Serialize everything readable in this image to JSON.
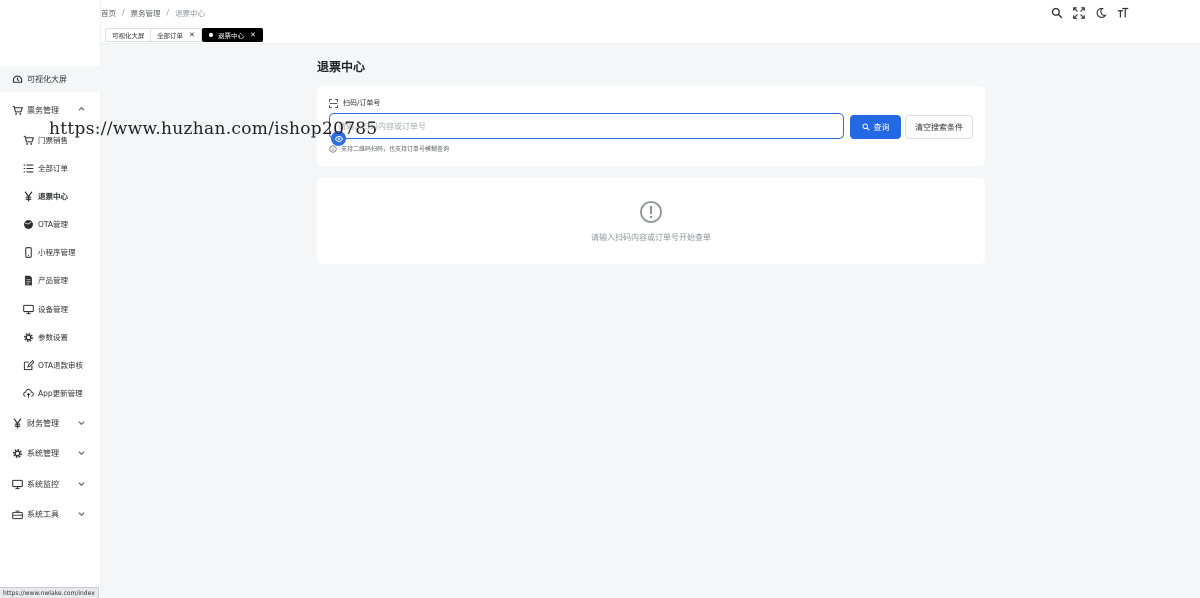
{
  "breadcrumb": {
    "home": "首页",
    "sep": "/",
    "section": "票务管理",
    "current": "退票中心"
  },
  "tabs": [
    {
      "label": "可视化大屏"
    },
    {
      "label": "全部订单",
      "close": "✕"
    },
    {
      "label": "退票中心",
      "close": "✕"
    }
  ],
  "sidebar": {
    "items": [
      {
        "label": "可视化大屏",
        "icon": "dashboard-icon"
      },
      {
        "label": "票务管理",
        "icon": "cart-icon"
      },
      {
        "label": "门票销售",
        "icon": "cart-icon"
      },
      {
        "label": "全部订单",
        "icon": "list-icon"
      },
      {
        "label": "退票中心",
        "icon": "yen-icon"
      },
      {
        "label": "OTA管理",
        "icon": "globe-icon"
      },
      {
        "label": "小程序管理",
        "icon": "mobile-icon"
      },
      {
        "label": "产品管理",
        "icon": "document-icon"
      },
      {
        "label": "设备管理",
        "icon": "monitor-icon"
      },
      {
        "label": "参数设置",
        "icon": "gear-icon"
      },
      {
        "label": "OTA退款审核",
        "icon": "edit-icon"
      },
      {
        "label": "App更新管理",
        "icon": "cloud-upload-icon"
      },
      {
        "label": "财务管理",
        "icon": "yen-icon"
      },
      {
        "label": "系统管理",
        "icon": "gear-icon"
      },
      {
        "label": "系统监控",
        "icon": "monitor-icon"
      },
      {
        "label": "系统工具",
        "icon": "toolbox-icon"
      }
    ]
  },
  "main": {
    "title": "退票中心",
    "field_label": "扫码/订单号",
    "search_placeholder": "请输入扫码内容或订单号",
    "query_button": "查询",
    "clear_button": "清空搜索条件",
    "hint": "支持二维码扫码，也支持订单号模糊查询",
    "empty_text": "请输入扫码内容或订单号开始查单"
  },
  "watermark": "https://www.huzhan.com/ishop20785",
  "status_url": "https://www.nwlake.com/index",
  "colors": {
    "primary": "#2468e4",
    "active_tab": "#000000",
    "background": "#f5f6f8"
  }
}
